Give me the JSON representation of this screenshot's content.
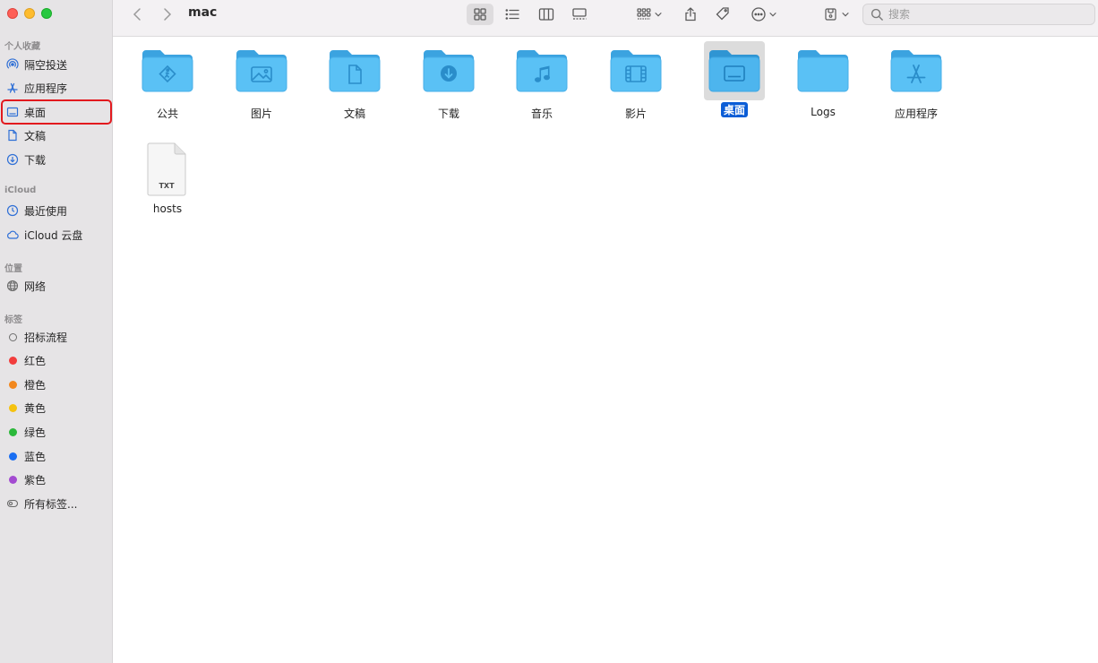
{
  "window": {
    "title": "mac"
  },
  "sidebar": {
    "favorites_title": "个人收藏",
    "favorites": [
      {
        "label": "隔空投送",
        "icon": "airdrop-icon"
      },
      {
        "label": "应用程序",
        "icon": "applications-icon"
      },
      {
        "label": "桌面",
        "icon": "desktop-icon"
      },
      {
        "label": "文稿",
        "icon": "document-icon"
      },
      {
        "label": "下载",
        "icon": "download-icon"
      }
    ],
    "icloud_title": "iCloud",
    "icloud": [
      {
        "label": "最近使用",
        "icon": "clock-icon"
      },
      {
        "label": "iCloud 云盘",
        "icon": "cloud-icon"
      }
    ],
    "locations_title": "位置",
    "locations": [
      {
        "label": "网络",
        "icon": "globe-icon"
      }
    ],
    "tags_title": "标签",
    "tags": [
      {
        "label": "招标流程",
        "color": "hollow"
      },
      {
        "label": "红色",
        "color": "#f23d3d"
      },
      {
        "label": "橙色",
        "color": "#f2871d"
      },
      {
        "label": "黄色",
        "color": "#f5c20f"
      },
      {
        "label": "绿色",
        "color": "#2bb83a"
      },
      {
        "label": "蓝色",
        "color": "#1a6ef2"
      },
      {
        "label": "紫色",
        "color": "#a34bd1"
      },
      {
        "label": "所有标签...",
        "color": "all"
      }
    ]
  },
  "toolbar": {
    "search_placeholder": "搜索"
  },
  "files": [
    {
      "label": "公共",
      "icon": "public-folder-icon"
    },
    {
      "label": "图片",
      "icon": "pictures-folder-icon"
    },
    {
      "label": "文稿",
      "icon": "documents-folder-icon"
    },
    {
      "label": "下载",
      "icon": "downloads-folder-icon"
    },
    {
      "label": "音乐",
      "icon": "music-folder-icon"
    },
    {
      "label": "影片",
      "icon": "movies-folder-icon"
    },
    {
      "label": "桌面",
      "icon": "desktop-folder-icon",
      "selected": true
    },
    {
      "label": "Logs",
      "icon": "folder-icon"
    },
    {
      "label": "应用程序",
      "icon": "applications-folder-icon"
    },
    {
      "label": "hosts",
      "icon": "txt-file-icon",
      "badge": "TXT"
    }
  ],
  "colors": {
    "folder": "#5ac1f5",
    "folder_dark": "#3ba3e0",
    "selection": "#0b5dd6",
    "highlight_box": "#e2191e"
  }
}
